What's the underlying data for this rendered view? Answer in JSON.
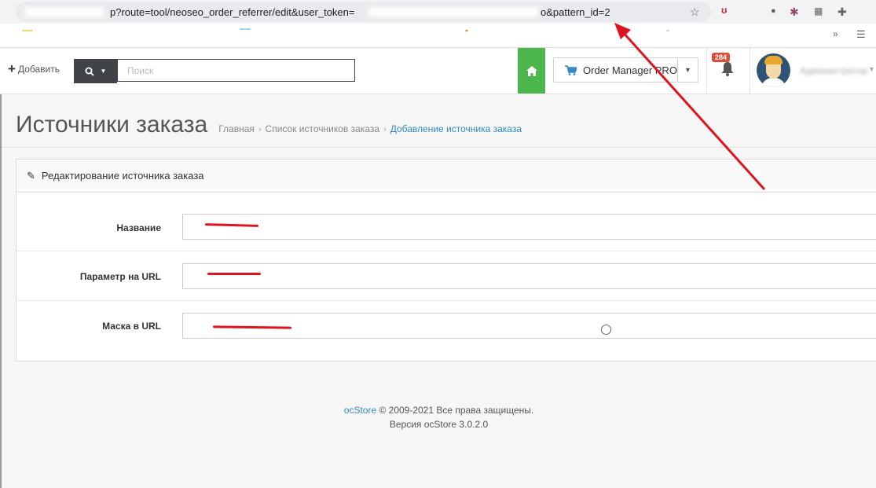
{
  "browser": {
    "url_part_1": "p?route=tool/neoseo_order_referrer/edit&user_token=",
    "url_part_2": "o&pattern_id=2",
    "star_icon": "star-icon",
    "overflow_label": "»"
  },
  "header": {
    "add_label": "Добавить",
    "search_placeholder": "Поиск",
    "order_manager_label": "Order Manager PRO",
    "notification_count": "284",
    "user_name": "Администратор"
  },
  "page": {
    "title": "Источники заказа",
    "breadcrumbs": [
      "Главная",
      "Список источников заказа",
      "Добавление источника заказа"
    ],
    "breadcrumb_separator": "›"
  },
  "panel": {
    "heading": "Редактирование источника заказа",
    "fields": [
      {
        "label": "Название",
        "value": ""
      },
      {
        "label": "Параметр на URL",
        "value": ""
      },
      {
        "label": "Маска в URL",
        "value": ""
      }
    ]
  },
  "footer": {
    "brand": "ocStore",
    "copyright": "© 2009-2021 Все права защищены.",
    "version": "Версия ocStore 3.0.2.0"
  },
  "colors": {
    "accent_green": "#4cb64c",
    "link_blue": "#3489c3",
    "badge_red": "#dd4b39",
    "annotation_red": "#e0141e"
  }
}
